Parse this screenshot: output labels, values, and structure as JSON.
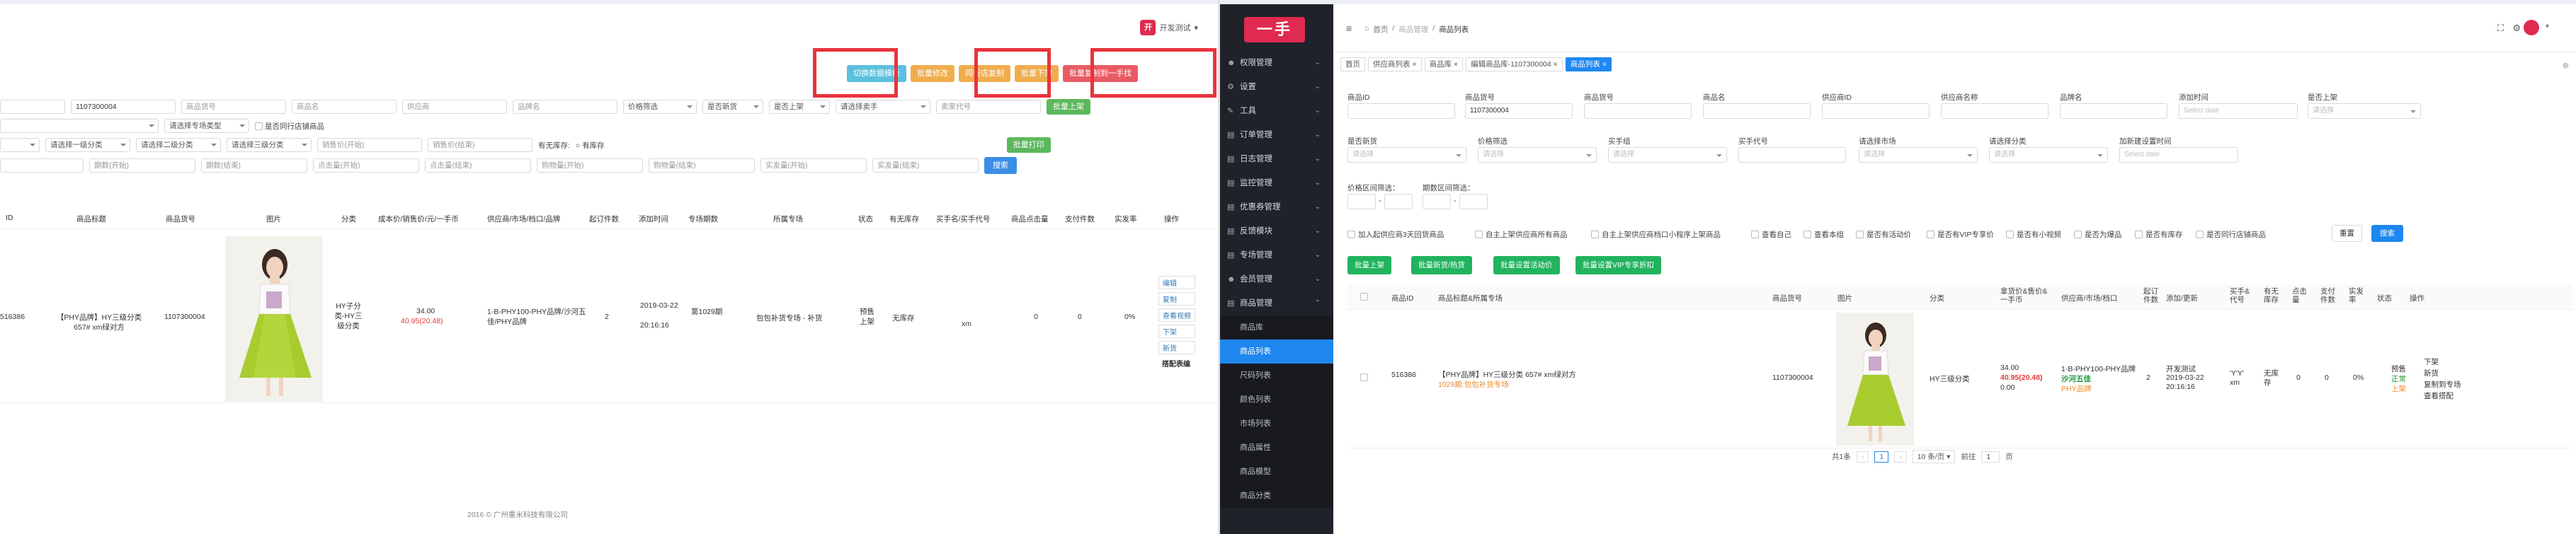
{
  "left": {
    "header_user": "开发测试",
    "actions": [
      "切换数据模板",
      "批量修改",
      "同行店复制",
      "批量下架",
      "批量复制到一手找"
    ],
    "filters": {
      "row1": {
        "first_value": "1107300004",
        "placeholders": [
          "商品货号",
          "商品名",
          "供应商",
          "品牌名"
        ],
        "selects": [
          "价格筛选",
          "是否新货",
          "是否上架",
          "请选择卖手"
        ],
        "trail_placeholder": "卖家代号",
        "btn": "批量上架"
      },
      "row2": {
        "select1": "请选择专场类型",
        "check_label": "是否同行店铺商品"
      },
      "row3": {
        "selects": [
          "请选择一级分类",
          "请选择二级分类",
          "请选择三级分类"
        ],
        "inputs": [
          "销售价(开始)",
          "销售价(结束)"
        ],
        "stock_label": "有无库存:",
        "stock_value": "有库存",
        "btn": "批量打印"
      },
      "row4": {
        "inputs": [
          "期数(开始)",
          "期数(结束)",
          "点击量(开始)",
          "点击量(结束)",
          "购物量(开始)",
          "购物量(结束)",
          "实发量(开始)",
          "实发量(结束)"
        ],
        "search_btn": "搜索"
      }
    },
    "table": {
      "headers": [
        "ID",
        "商品标题",
        "商品货号",
        "图片",
        "分类",
        "成本价/销售价/元/一手币",
        "供应商/市场/档口/品牌",
        "起订件数",
        "添加时间",
        "专场期数",
        "所属专场",
        "状态",
        "有无库存",
        "买手名/买手代号",
        "商品点击量",
        "支付件数",
        "实发率",
        "操作"
      ],
      "row": {
        "id": "516386",
        "title": "【PHY品牌】HY三级分类 657# xm绿对方",
        "sku": "1107300004",
        "category": "HY子分类-HY三级分类",
        "cost": "34.00",
        "sale": "40.95(20.48)",
        "supplier": "1-B-PHY100-PHY品牌/沙河五佳/PHY品牌",
        "min_qty": "2",
        "added_date": "2019-03-22",
        "added_time": "20:16:16",
        "period": "第1029期",
        "special": "包包补货专场 - 补货",
        "status": "预售上架",
        "stock": "无库存",
        "buyer": "xm",
        "clicks": "0",
        "paid": "0",
        "rate": "0%",
        "ops": [
          "编辑",
          "复制",
          "查看视频",
          "下架",
          "新货",
          "搭配表编"
        ]
      }
    },
    "footer": "2016 © 广州重米科技有限公司"
  },
  "sidebar": {
    "logo": "一手",
    "menus": [
      "权限管理",
      "设置",
      "工具",
      "订单管理",
      "日志管理",
      "监控管理",
      "优惠券管理",
      "反馈模块",
      "专场管理",
      "会员管理",
      "商品管理"
    ],
    "sub": [
      "商品库",
      "商品列表",
      "尺码列表",
      "颜色列表",
      "市场列表",
      "商品属性",
      "商品模型",
      "商品分类"
    ]
  },
  "right": {
    "breadcrumb": [
      "首页",
      "商品管理",
      "商品列表"
    ],
    "tabs": [
      "首页",
      "供应商列表",
      "商品库",
      "编辑商品库-1107300004",
      "商品列表"
    ],
    "form": {
      "row1": [
        {
          "label": "商品ID",
          "value": "",
          "ph": ""
        },
        {
          "label": "商品货号",
          "value": "1107300004",
          "ph": ""
        },
        {
          "label": "商品货号",
          "value": "",
          "ph": ""
        },
        {
          "label": "商品名",
          "value": "",
          "ph": ""
        },
        {
          "label": "供应商ID",
          "value": "",
          "ph": ""
        },
        {
          "label": "供应商名称",
          "value": "",
          "ph": ""
        },
        {
          "label": "品牌名",
          "value": "",
          "ph": ""
        },
        {
          "label": "添加时间",
          "value": "",
          "ph": "Select date"
        },
        {
          "label": "是否上架",
          "value": "",
          "ph": "请选择"
        }
      ],
      "row2": [
        {
          "label": "是否新货",
          "value": "",
          "ph": "请选择"
        },
        {
          "label": "价格筛选",
          "value": "",
          "ph": "请选择"
        },
        {
          "label": "买手组",
          "value": "",
          "ph": "请选择"
        },
        {
          "label": "买手代号",
          "value": "",
          "ph": ""
        },
        {
          "label": "请选择市场",
          "value": "",
          "ph": "请选择"
        },
        {
          "label": "请选择分类",
          "value": "",
          "ph": "请选择"
        },
        {
          "label": "加新建设置时间",
          "value": "",
          "ph": "Select date"
        }
      ],
      "range1": "价格区间筛选：",
      "range2": "期数区间筛选：",
      "checks": [
        "加入起供应商3天回货商品",
        "自主上架供应商所有商品",
        "自主上架供应商档口小程序上架商品",
        "查看自己",
        "查看本组",
        "是否有活动价",
        "是否有VIP专享价",
        "是否有小视频",
        "是否为爆品",
        "是否有库存",
        "是否同行店铺商品"
      ],
      "reset": "重置",
      "search": "搜索"
    },
    "btns": [
      "批量上架",
      "批量新货/热货",
      "批量设置活动价",
      "批量设置VIP专享折扣"
    ],
    "headers": [
      "商品ID",
      "商品标题&所属专场",
      "商品货号",
      "图片",
      "分类",
      "拿货价&售价&一手币",
      "供应商/市场/档口",
      "起订件数",
      "添加/更新",
      "买手&代号",
      "有无库存",
      "点击量",
      "支付件数",
      "实发率",
      "状态",
      "操作"
    ],
    "row": {
      "id": "516386",
      "title": "【PHY品牌】HY三级分类 657# xm绿对方",
      "special": "1029期:包包补货专场",
      "sku": "1107300004",
      "category": "HY三级分类",
      "price1": "34.00",
      "price2": "40.95(20.48)",
      "price3": "0.00",
      "supplier": "1-B-PHY100-PHY品牌",
      "market": "沙河五佳",
      "brand": "PHY品牌",
      "qty": "2",
      "updated": "开发测试",
      "time": "2019-03-22 20:16:16",
      "buyer": "'Y'Y' xm",
      "stock": "无库存",
      "clicks": "0",
      "paid": "0",
      "rate": "0%",
      "status": [
        "预售",
        "正常",
        "上架"
      ],
      "ops": [
        "下架",
        "新货",
        "复制到专场",
        "查看搭配"
      ]
    },
    "pager": {
      "total": "共1条",
      "page": "1",
      "per": "10 条/页",
      "goto": "前往",
      "goto_val": "1",
      "unit": "页"
    }
  }
}
